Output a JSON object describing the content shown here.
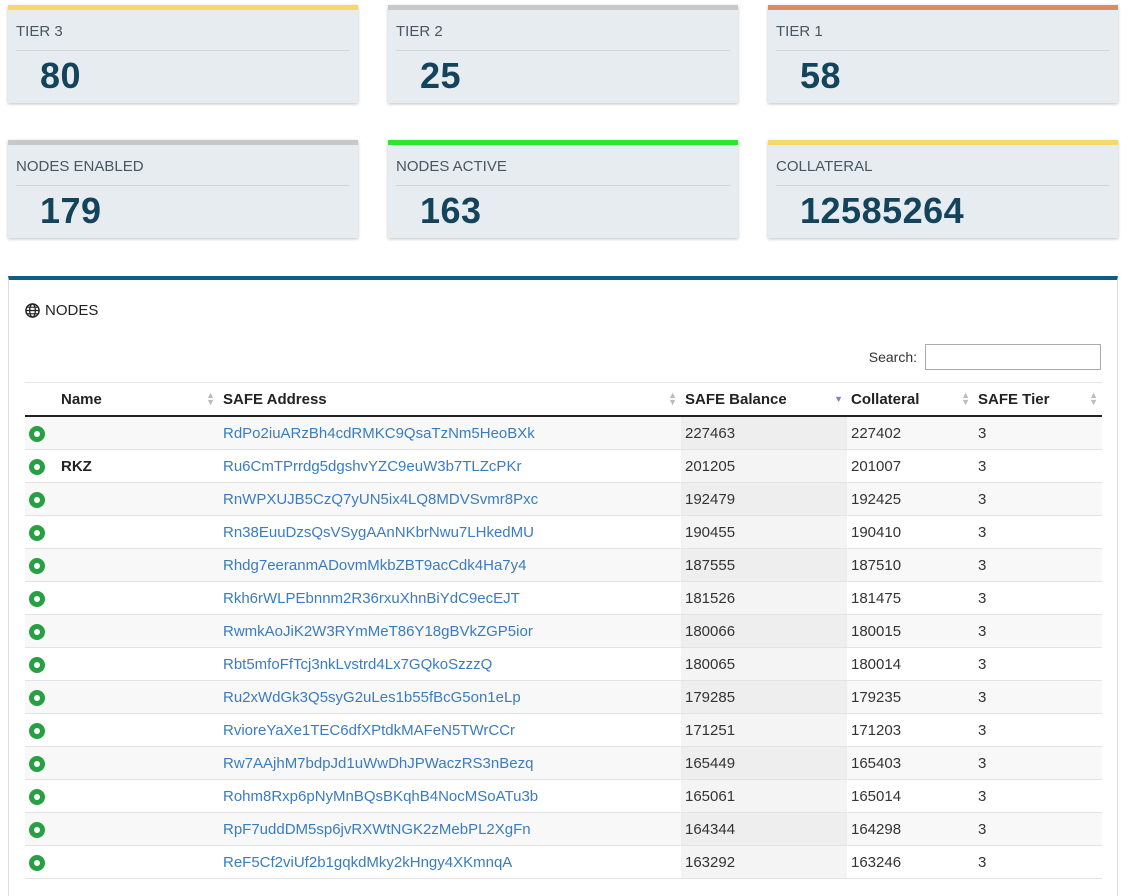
{
  "stats": [
    {
      "label": "TIER 3",
      "value": "80",
      "color": "#f7d96b"
    },
    {
      "label": "TIER 2",
      "value": "25",
      "color": "#c8c8c8"
    },
    {
      "label": "TIER 1",
      "value": "58",
      "color": "#e08b58"
    },
    {
      "label": "NODES ENABLED",
      "value": "179",
      "color": "#c8c8c8"
    },
    {
      "label": "NODES ACTIVE",
      "value": "163",
      "color": "#2ee62e"
    },
    {
      "label": "COLLATERAL",
      "value": "12585264",
      "color": "#f7d96b"
    }
  ],
  "panel": {
    "title": "NODES",
    "icon": "globe-icon",
    "search_label": "Search:",
    "search_value": ""
  },
  "table": {
    "columns": [
      "Name",
      "SAFE Address",
      "SAFE Balance",
      "Collateral",
      "SAFE Tier"
    ],
    "rows": [
      {
        "name": "",
        "address": "RdPo2iuARzBh4cdRMKC9QsaTzNm5HeoBXk",
        "balance": "227463",
        "collateral": "227402",
        "tier": "3"
      },
      {
        "name": "RKZ",
        "address": "Ru6CmTPrrdg5dgshvYZC9euW3b7TLZcPKr",
        "balance": "201205",
        "collateral": "201007",
        "tier": "3"
      },
      {
        "name": "",
        "address": "RnWPXUJB5CzQ7yUN5ix4LQ8MDVSvmr8Pxc",
        "balance": "192479",
        "collateral": "192425",
        "tier": "3"
      },
      {
        "name": "",
        "address": "Rn38EuuDzsQsVSygAAnNKbrNwu7LHkedMU",
        "balance": "190455",
        "collateral": "190410",
        "tier": "3"
      },
      {
        "name": "",
        "address": "Rhdg7eeranmADovmMkbZBT9acCdk4Ha7y4",
        "balance": "187555",
        "collateral": "187510",
        "tier": "3"
      },
      {
        "name": "",
        "address": "Rkh6rWLPEbnnm2R36rxuXhnBiYdC9ecEJT",
        "balance": "181526",
        "collateral": "181475",
        "tier": "3"
      },
      {
        "name": "",
        "address": "RwmkAoJiK2W3RYmMeT86Y18gBVkZGP5ior",
        "balance": "180066",
        "collateral": "180015",
        "tier": "3"
      },
      {
        "name": "",
        "address": "Rbt5mfoFfTcj3nkLvstrd4Lx7GQkoSzzzQ",
        "balance": "180065",
        "collateral": "180014",
        "tier": "3"
      },
      {
        "name": "",
        "address": "Ru2xWdGk3Q5syG2uLes1b55fBcG5on1eLp",
        "balance": "179285",
        "collateral": "179235",
        "tier": "3"
      },
      {
        "name": "",
        "address": "RvioreYaXe1TEC6dfXPtdkMAFeN5TWrCCr",
        "balance": "171251",
        "collateral": "171203",
        "tier": "3"
      },
      {
        "name": "",
        "address": "Rw7AAjhM7bdpJd1uWwDhJPWaczRS3nBezq",
        "balance": "165449",
        "collateral": "165403",
        "tier": "3"
      },
      {
        "name": "",
        "address": "Rohm8Rxp6pNyMnBQsBKqhB4NocMSoATu3b",
        "balance": "165061",
        "collateral": "165014",
        "tier": "3"
      },
      {
        "name": "",
        "address": "RpF7uddDM5sp6jvRXWtNGK2zMebPL2XgFn",
        "balance": "164344",
        "collateral": "164298",
        "tier": "3"
      },
      {
        "name": "",
        "address": "ReF5Cf2viUf2b1gqkdMky2kHngy4XKmnqA",
        "balance": "163292",
        "collateral": "163246",
        "tier": "3"
      }
    ]
  }
}
